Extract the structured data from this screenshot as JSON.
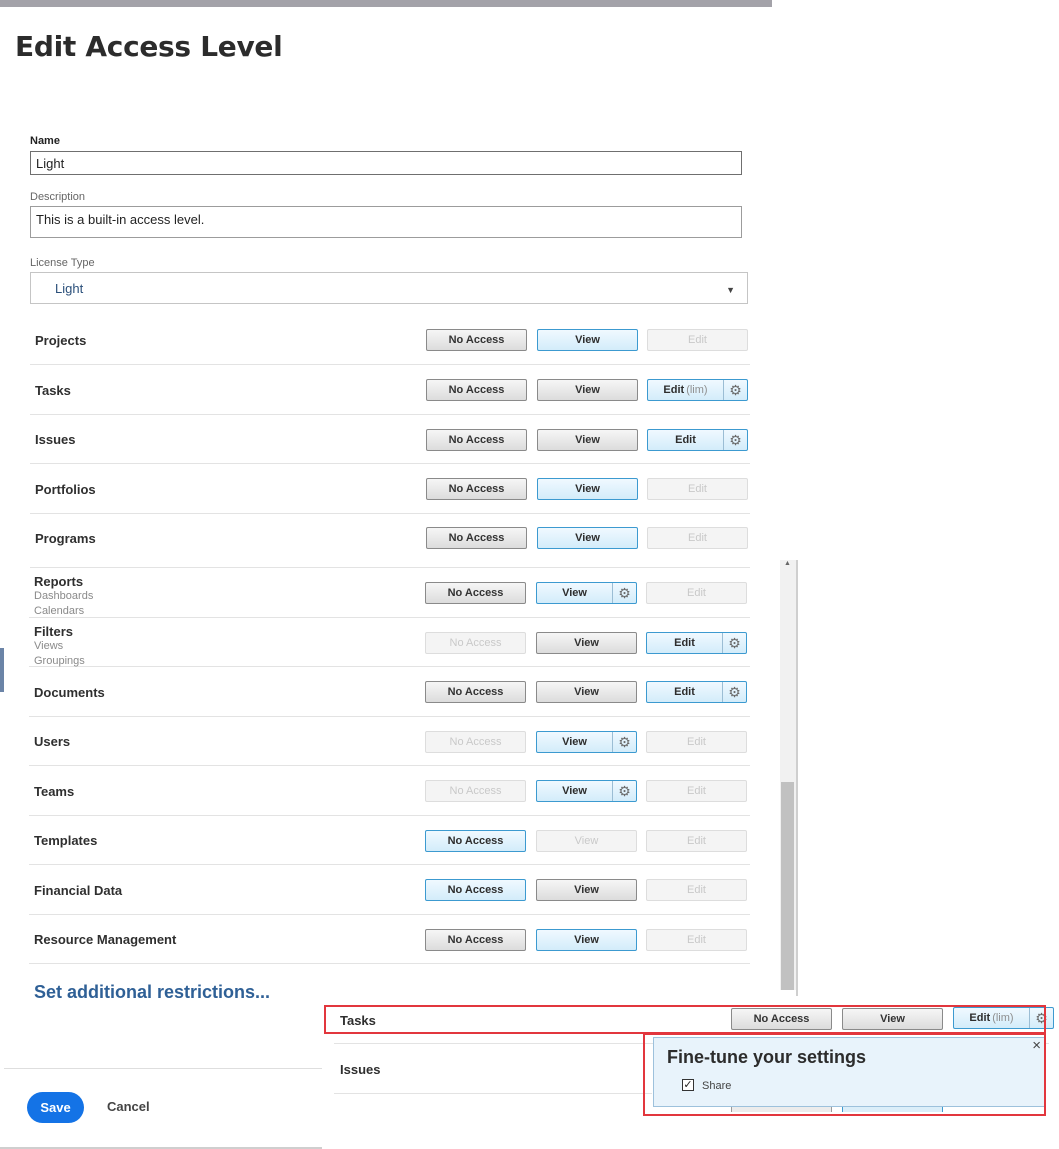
{
  "page_title": "Edit Access Level",
  "form": {
    "name_label": "Name",
    "name_value": "Light",
    "description_label": "Description",
    "description_value": "This is a built-in access level.",
    "license_label": "License Type",
    "license_value": "Light"
  },
  "buttons": {
    "no_access": "No Access",
    "view": "View",
    "edit": "Edit",
    "edit_lim": "(lim)",
    "gear": "⚙"
  },
  "rows": [
    {
      "label": "Projects",
      "sub": [],
      "no_access": "normal",
      "view": "selected",
      "edit": "disabled"
    },
    {
      "label": "Tasks",
      "sub": [],
      "no_access": "normal",
      "view": "normal",
      "edit": "selected-lim-gear"
    },
    {
      "label": "Issues",
      "sub": [],
      "no_access": "normal",
      "view": "normal",
      "edit": "selected-gear"
    },
    {
      "label": "Portfolios",
      "sub": [],
      "no_access": "normal",
      "view": "selected",
      "edit": "disabled"
    },
    {
      "label": "Programs",
      "sub": [],
      "no_access": "normal",
      "view": "selected",
      "edit": "disabled"
    },
    {
      "label": "Reports",
      "sub": [
        "Dashboards",
        "Calendars"
      ],
      "no_access": "normal",
      "view": "selected-gear",
      "edit": "disabled"
    },
    {
      "label": "Filters",
      "sub": [
        "Views",
        "Groupings"
      ],
      "no_access": "disabled",
      "view": "normal",
      "edit": "selected-gear"
    },
    {
      "label": "Documents",
      "sub": [],
      "no_access": "normal",
      "view": "normal",
      "edit": "selected-gear"
    },
    {
      "label": "Users",
      "sub": [],
      "no_access": "disabled",
      "view": "selected-gear",
      "edit": "disabled"
    },
    {
      "label": "Teams",
      "sub": [],
      "no_access": "disabled",
      "view": "selected-gear",
      "edit": "disabled"
    },
    {
      "label": "Templates",
      "sub": [],
      "no_access": "selected",
      "view": "disabled",
      "edit": "disabled"
    },
    {
      "label": "Financial Data",
      "sub": [],
      "no_access": "selected",
      "view": "normal",
      "edit": "disabled"
    },
    {
      "label": "Resource Management",
      "sub": [],
      "no_access": "normal",
      "view": "selected",
      "edit": "disabled"
    }
  ],
  "set_restrictions_link": "Set additional restrictions...",
  "footer": {
    "save": "Save",
    "cancel": "Cancel"
  },
  "inset": {
    "tasks_label": "Tasks",
    "issues_label": "Issues",
    "popover_title": "Fine-tune your settings",
    "popover_close": "×",
    "share_label": "Share",
    "share_checked": true
  },
  "colors": {
    "accent_blue": "#1473e6",
    "selected_border": "#3c9ad0",
    "highlight_red": "#e2363d",
    "link": "#2f6096"
  }
}
